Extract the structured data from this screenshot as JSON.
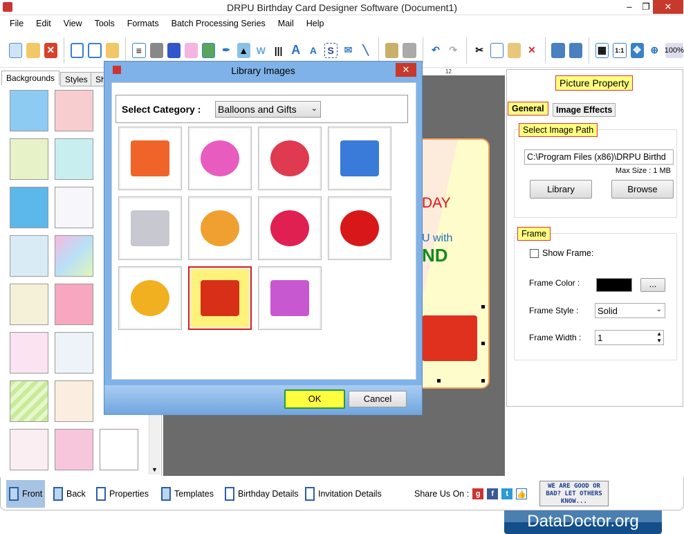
{
  "window": {
    "title": "DRPU Birthday Card Designer Software (Document1)",
    "minimize": "–",
    "restore": "❐",
    "close": "✕"
  },
  "menu": [
    "File",
    "Edit",
    "View",
    "Tools",
    "Formats",
    "Batch Processing Series",
    "Mail",
    "Help"
  ],
  "toolbar": {
    "zoom": "100%"
  },
  "left_panel": {
    "tabs": [
      "Backgrounds",
      "Styles",
      "Sh"
    ]
  },
  "ruler": {
    "mark": "12"
  },
  "card": {
    "line1": "DAY",
    "line2": "U with",
    "line3": "ND"
  },
  "right_panel": {
    "title": "Picture Property",
    "tabs": [
      "General",
      "Image Effects"
    ],
    "select_image_path": "Select Image Path",
    "path_value": "C:\\Program Files (x86)\\DRPU Birthd",
    "max_size": "Max Size : 1 MB",
    "library_button": "Library",
    "browse_button": "Browse",
    "frame_label": "Frame",
    "show_frame": "Show Frame:",
    "show_frame_checked": false,
    "frame_color_label": "Frame Color :",
    "frame_color": "#000000",
    "frame_color_button": "...",
    "frame_style_label": "Frame Style :",
    "frame_style": "Solid",
    "frame_width_label": "Frame Width :",
    "frame_width": "1"
  },
  "dialog": {
    "title": "Library Images",
    "close": "✕",
    "category_label": "Select Category :",
    "category_value": "Balloons and Gifts",
    "items": [
      "gift-box-orange",
      "balloons-swirl",
      "balloons-bunch",
      "gift-box-blue",
      "gift-box-silver",
      "balloons-card",
      "heart-balloons",
      "red-balloons",
      "colorful-balloons",
      "gift-box-red",
      "gift-boxes-pile"
    ],
    "selected_index": 9,
    "ok": "OK",
    "cancel": "Cancel"
  },
  "bottom_bar": {
    "items": [
      "Front",
      "Back",
      "Properties",
      "Templates",
      "Birthday Details",
      "Invitation Details"
    ],
    "share_label": "Share Us On :",
    "feedback": "WE ARE GOOD OR BAD? LET OTHERS KNOW..."
  },
  "watermark": "DataDoctor.org"
}
